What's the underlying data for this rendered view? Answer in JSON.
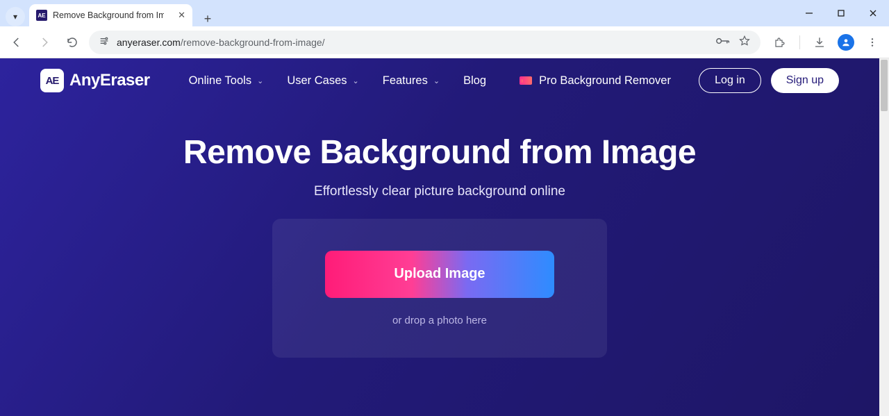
{
  "browser": {
    "tab_title": "Remove Background from Imag",
    "favicon_text": "AE",
    "url_host": "anyeraser.com",
    "url_path": "/remove-background-from-image/"
  },
  "site": {
    "logo_mark": "AE",
    "logo_text": "AnyEraser",
    "nav": {
      "online_tools": "Online Tools",
      "user_cases": "User Cases",
      "features": "Features",
      "blog": "Blog"
    },
    "pro_link": "Pro Background Remover",
    "auth": {
      "login": "Log in",
      "signup": "Sign up"
    }
  },
  "hero": {
    "title": "Remove Background from Image",
    "subtitle": "Effortlessly clear picture background online",
    "upload_label": "Upload Image",
    "drop_hint": "or drop a photo here"
  }
}
